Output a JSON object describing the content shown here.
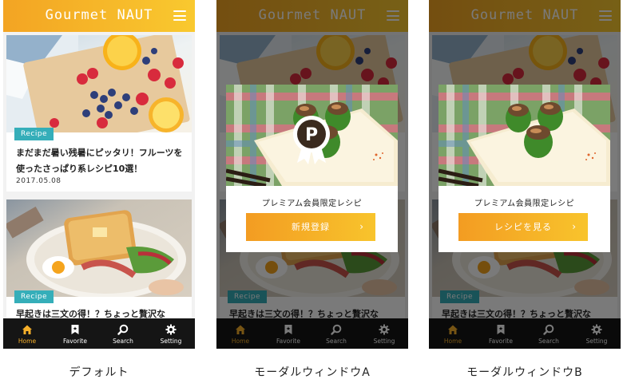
{
  "app": {
    "title": "Gourmet NAUT"
  },
  "colors": {
    "accent": "#f7b02a",
    "badge": "#35aeb9",
    "tabbar": "#151515"
  },
  "articles": [
    {
      "badge": "Recipe",
      "title": "まだまだ暑い残暑にピッタリ！フルーツを使ったさっぱり系レシピ10選！",
      "date": "2017.05.08",
      "image": "fruit-photo"
    },
    {
      "badge": "Recipe",
      "title": "早起きは三文の得！？ちょっと贅沢な",
      "image": "toast-breakfast-photo"
    }
  ],
  "tabs": [
    {
      "label": "Home",
      "icon": "home-icon",
      "active": true
    },
    {
      "label": "Favorite",
      "icon": "bookmark-icon",
      "active": false
    },
    {
      "label": "Search",
      "icon": "search-icon",
      "active": false
    },
    {
      "label": "Setting",
      "icon": "gear-icon",
      "active": false
    }
  ],
  "modal_a": {
    "caption": "プレミアム会員限定レシピ",
    "button": "新規登録",
    "arrow": "›",
    "emblem": "P"
  },
  "modal_b": {
    "caption": "プレミアム会員限定レシピ",
    "button": "レシピを見る",
    "arrow": "›"
  },
  "captions": [
    "デフォルト",
    "モーダルウィンドウA",
    "モーダルウィンドウB"
  ]
}
